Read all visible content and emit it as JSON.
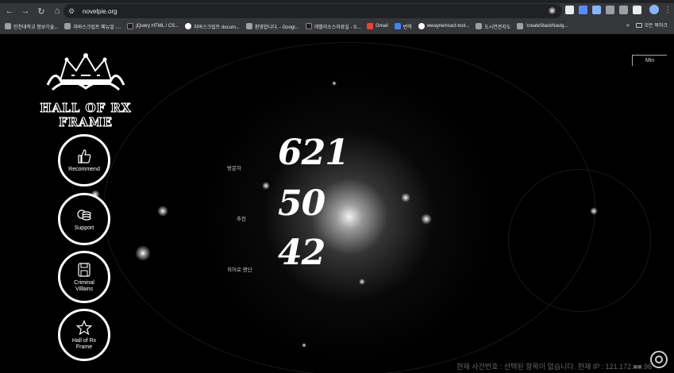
{
  "browser": {
    "url": "novelpie.org",
    "bookmarks": [
      {
        "label": "인천대학교 정보기술...",
        "icon": "globe-icon"
      },
      {
        "label": "자바스크립트 메뉴얼 -...",
        "icon": "globe-icon"
      },
      {
        "label": "jQuery HTML / CS...",
        "icon": "page-icon"
      },
      {
        "label": "자바스크립트 docum...",
        "icon": "page-icon"
      },
      {
        "label": "환영합니다. - Googl...",
        "icon": "page-icon"
      },
      {
        "label": "개별리소스자료실 - S...",
        "icon": "app-icon"
      },
      {
        "label": "Gmail",
        "icon": "gmail-icon"
      },
      {
        "label": "번역",
        "icon": "translate-icon"
      },
      {
        "label": "wwayne/react-tool...",
        "icon": "github-icon"
      },
      {
        "label": "도시연관지도",
        "icon": "globe-icon"
      },
      {
        "label": "'createStackNavig...",
        "icon": "globe-icon"
      }
    ],
    "all_bookmarks_label": "모든 북마크"
  },
  "site": {
    "logo_title": "HALL OF RX FRAME",
    "min_button": "Min",
    "nav": [
      {
        "label": "Recommend",
        "icon": "thumbs-up-icon"
      },
      {
        "label": "Support",
        "icon": "coins-icon"
      },
      {
        "label": "Criminal Villains",
        "icon": "skull-icon"
      },
      {
        "label": "Hall of Rx Frame",
        "icon": "star-icon"
      }
    ],
    "stats": [
      {
        "label": "방문자",
        "value": "621"
      },
      {
        "label": "추천",
        "value": "50"
      },
      {
        "label": "히어로 명단",
        "value": "42"
      }
    ],
    "footer": "현재 사건번호 : 선택된 항목이 없습니다. 현재 IP : 121.172.■■.96"
  },
  "colors": {
    "background": "#000000",
    "accent": "#ffffff"
  }
}
